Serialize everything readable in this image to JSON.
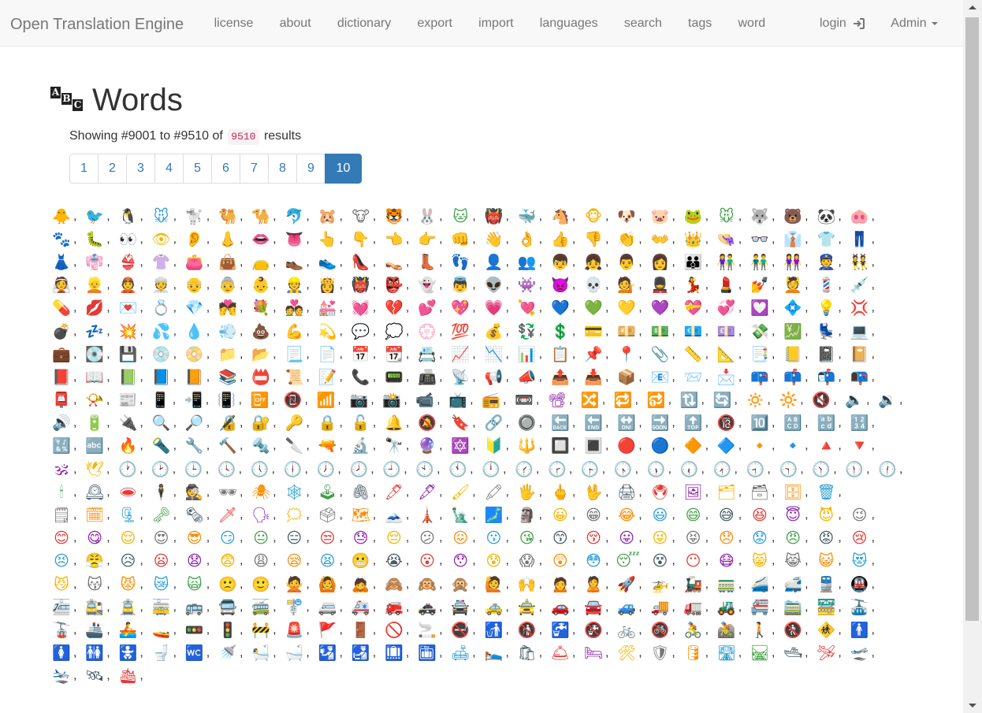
{
  "navbar": {
    "brand": "Open Translation Engine",
    "links": [
      "license",
      "about",
      "dictionary",
      "export",
      "import",
      "languages",
      "search",
      "tags",
      "word"
    ],
    "login_label": "login",
    "admin_label": "Admin"
  },
  "header": {
    "title": "Words",
    "icon_letters": [
      "A",
      "B",
      "C"
    ]
  },
  "results": {
    "prefix": "Showing #9001 to #9510 of",
    "count": "9510",
    "suffix": "results"
  },
  "pagination": {
    "pages": [
      "1",
      "2",
      "3",
      "4",
      "5",
      "6",
      "7",
      "8",
      "9",
      "10"
    ],
    "active_page": "10"
  },
  "colors": {
    "brand_blue": "#337ab7",
    "navbar_bg": "#f8f8f8",
    "count_pink": "#c7254e"
  },
  "separator": ",",
  "emoji_rows": [
    [
      "🐥",
      "🐦",
      "🐧",
      "🐭",
      "🐩",
      "🐫",
      "🐪",
      "🐬",
      "🐹",
      "🐮",
      "🐯",
      "🐰",
      "🐱",
      "👹",
      "🐳",
      "🐴",
      "🐵",
      "🐶",
      "🐷",
      "🐸",
      "🐭",
      "🐺",
      "🐻",
      "🐼",
      "🐽"
    ],
    [
      "🐾",
      "🐛",
      "👀",
      "👁",
      "👂",
      "👃",
      "👄",
      "👅",
      "👆",
      "👇",
      "👈",
      "👉",
      "👊",
      "👋",
      "👌",
      "👍",
      "👎",
      "👏",
      "👐",
      "👑",
      "👒",
      "👓",
      "👔",
      "👕",
      "👖"
    ],
    [
      "👗",
      "👘",
      "👙",
      "👚",
      "👛",
      "👜",
      "👝",
      "👞",
      "👟",
      "👠",
      "👡",
      "👢",
      "👣",
      "👤",
      "👥",
      "👦",
      "👧",
      "👨",
      "👩",
      "👪",
      "👫",
      "👬",
      "👭",
      "👮",
      "👯"
    ],
    [
      "👰",
      "👱",
      "👲",
      "👳",
      "👴",
      "👵",
      "👶",
      "👷",
      "👸",
      "👹",
      "👺",
      "👻",
      "👼",
      "👽",
      "👾",
      "👿",
      "💀",
      "💁",
      "💂",
      "💃",
      "💄",
      "💅",
      "💆",
      "💈",
      "💉"
    ],
    [
      "💊",
      "💋",
      "💌",
      "💍",
      "💎",
      "💏",
      "💐",
      "💑",
      "💒",
      "💓",
      "💔",
      "💕",
      "💖",
      "💗",
      "💘",
      "💙",
      "💚",
      "💛",
      "💜",
      "💝",
      "💞",
      "💟",
      "💠",
      "💡",
      "💢"
    ],
    [
      "💣",
      "💤",
      "💥",
      "💦",
      "💧",
      "💨",
      "💩",
      "💪",
      "💫",
      "💬",
      "💭",
      "💮",
      "💯",
      "💰",
      "💱",
      "💲",
      "💳",
      "💴",
      "💵",
      "💶",
      "💷",
      "💸",
      "💹",
      "💺",
      "💻"
    ],
    [
      "💼",
      "💽",
      "💾",
      "💿",
      "📀",
      "📁",
      "📂",
      "📃",
      "📄",
      "📅",
      "📆",
      "📇",
      "📈",
      "📉",
      "📊",
      "📋",
      "📌",
      "📍",
      "📎",
      "📏",
      "📐",
      "📑",
      "📒",
      "📓",
      "📔"
    ],
    [
      "📕",
      "📖",
      "📗",
      "📘",
      "📙",
      "📚",
      "📛",
      "📜",
      "📝",
      "📞",
      "📟",
      "📠",
      "📡",
      "📢",
      "📣",
      "📤",
      "📥",
      "📦",
      "📧",
      "📨",
      "📩",
      "📪",
      "📫",
      "📬",
      "📭"
    ],
    [
      "📮",
      "📯",
      "📰",
      "📱",
      "📲",
      "📳",
      "📴",
      "📵",
      "📶",
      "📷",
      "📸",
      "📹",
      "📺",
      "📻",
      "📼",
      "📽",
      "🔀",
      "🔁",
      "🔂",
      "🔃",
      "🔄",
      "🔅",
      "🔆",
      "🔇",
      "🔈",
      "🔉"
    ],
    [
      "🔊",
      "🔋",
      "🔌",
      "🔍",
      "🔎",
      "🔏",
      "🔐",
      "🔑",
      "🔒",
      "🔓",
      "🔔",
      "🔕",
      "🔖",
      "🔗",
      "🔘",
      "🔙",
      "🔚",
      "🔛",
      "🔜",
      "🔝",
      "🔞",
      "🔟",
      "🔠",
      "🔡",
      "🔢"
    ],
    [
      "🔣",
      "🔤",
      "🔥",
      "🔦",
      "🔧",
      "🔨",
      "🔩",
      "🔪",
      "🔫",
      "🔬",
      "🔭",
      "🔮",
      "🔯",
      "🔰",
      "🔱",
      "🔲",
      "🔳",
      "🔴",
      "🔵",
      "🔶",
      "🔷",
      "🔸",
      "🔹",
      "🔺",
      "🔻"
    ],
    [
      "🕉",
      "🕊",
      "🕐",
      "🕑",
      "🕒",
      "🕓",
      "🕔",
      "🕕",
      "🕖",
      "🕗",
      "🕘",
      "🕙",
      "🕚",
      "🕛",
      "🕜",
      "🕝",
      "🕞",
      "🕟",
      "🕠",
      "🕡",
      "🕢",
      "🕣",
      "🕤",
      "🕥",
      "🕦",
      "🕧"
    ],
    [
      "🕯",
      "🕰",
      "🕳",
      "🕴",
      "🕵",
      "🕶",
      "🕷",
      "🕸",
      "🕹",
      "🖇",
      "🖊",
      "🖋",
      "🖌",
      "🖍",
      "🖐",
      "🖕",
      "🖖",
      "🖨",
      "🖲",
      "🖼",
      "🗂",
      "🗃",
      "🗄",
      "🗑"
    ],
    [
      "🗒",
      "🗓",
      "🗜",
      "🗝",
      "🗞",
      "🗡",
      "🗣",
      "🗯",
      "🗳",
      "🗺",
      "🗻",
      "🗼",
      "🗽",
      "🗾",
      "🗿",
      "😀",
      "😁",
      "😂",
      "😃",
      "😄",
      "😅",
      "😆",
      "😇",
      "😈",
      "😉"
    ],
    [
      "😊",
      "😋",
      "😌",
      "😍",
      "😎",
      "😏",
      "😐",
      "😑",
      "😒",
      "😓",
      "😔",
      "😕",
      "😖",
      "😗",
      "😘",
      "😙",
      "😚",
      "😛",
      "😜",
      "😝",
      "😞",
      "😟",
      "😠",
      "😡",
      "😢"
    ],
    [
      "😣",
      "😤",
      "😥",
      "😦",
      "😧",
      "😨",
      "😩",
      "😪",
      "😫",
      "😬",
      "😭",
      "😮",
      "😯",
      "😰",
      "😱",
      "😲",
      "😳",
      "😴",
      "😵",
      "😶",
      "😷",
      "😸",
      "😹",
      "😺",
      "😻"
    ],
    [
      "😼",
      "😽",
      "😾",
      "😿",
      "🙀",
      "🙁",
      "🙂",
      "🙅",
      "🙆",
      "🙇",
      "🙈",
      "🙉",
      "🙊",
      "🙋",
      "🙌",
      "🙍",
      "🙎",
      "🚀",
      "🚁",
      "🚂",
      "🚃",
      "🚄",
      "🚅",
      "🚆",
      "🚇"
    ],
    [
      "🚈",
      "🚉",
      "🚊",
      "🚋",
      "🚌",
      "🚍",
      "🚎",
      "🚏",
      "🚐",
      "🚑",
      "🚒",
      "🚓",
      "🚔",
      "🚕",
      "🚖",
      "🚗",
      "🚘",
      "🚙",
      "🚚",
      "🚛",
      "🚜",
      "🚝",
      "🚞",
      "🚟",
      "🚠"
    ],
    [
      "🚡",
      "🚢",
      "🚣",
      "🚤",
      "🚥",
      "🚦",
      "🚧",
      "🚨",
      "🚩",
      "🚪",
      "🚫",
      "🚬",
      "🚭",
      "🚮",
      "🚯",
      "🚰",
      "🚱",
      "🚲",
      "🚳",
      "🚴",
      "🚵",
      "🚶",
      "🚷",
      "🚸",
      "🚹"
    ],
    [
      "🚺",
      "🚻",
      "🚼",
      "🚽",
      "🚾",
      "🚿",
      "🛀",
      "🛁",
      "🛂",
      "🛃",
      "🛄",
      "🛅",
      "🛋",
      "🛌",
      "🛍",
      "🛎",
      "🛏",
      "🛠",
      "🛡",
      "🛢",
      "🛣",
      "🛤",
      "🛥",
      "🛩",
      "🛫"
    ],
    [
      "🛬",
      "🛰",
      "🛳"
    ]
  ]
}
